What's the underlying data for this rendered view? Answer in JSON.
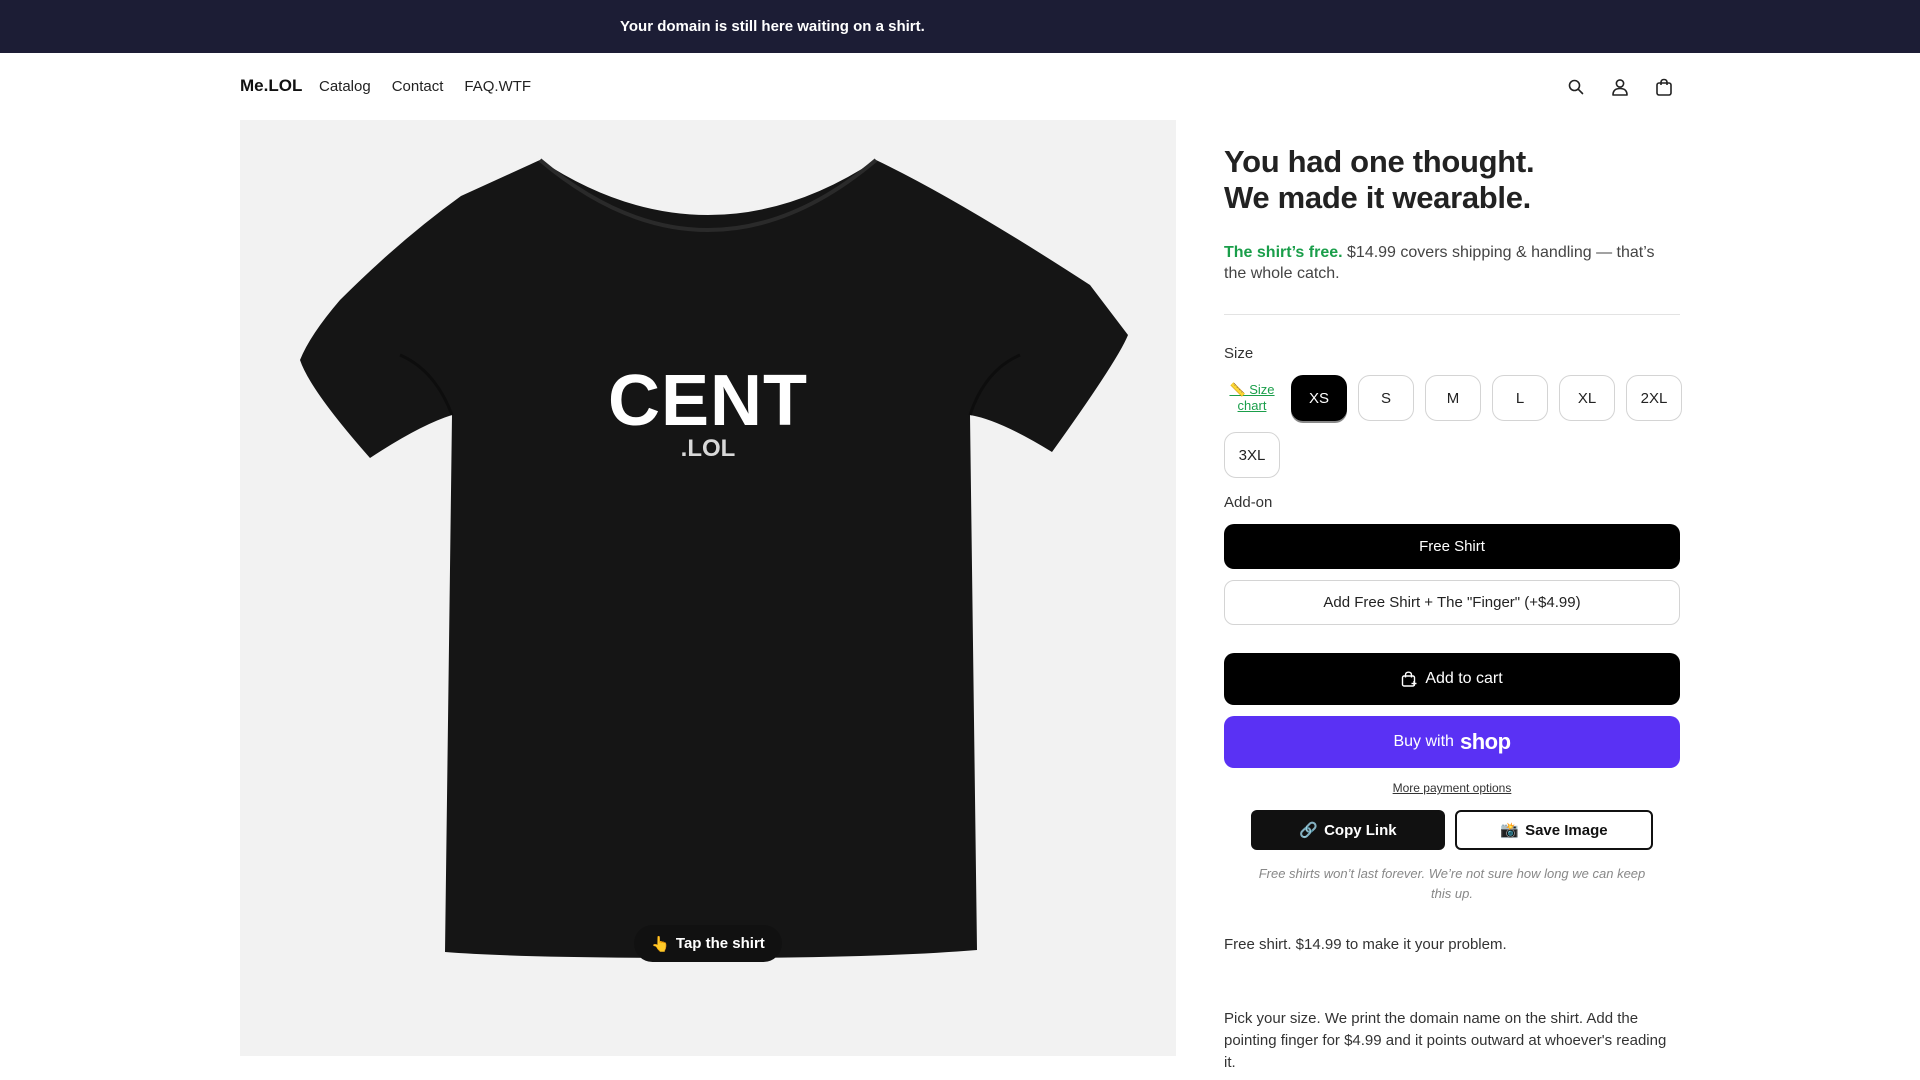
{
  "announcement": "Your domain is still here waiting on a shirt.",
  "header": {
    "logo": "Me.LOL",
    "nav": [
      "Catalog",
      "Contact",
      "FAQ.WTF"
    ]
  },
  "product": {
    "shirt_word": "CENT",
    "shirt_suffix": ".LOL",
    "tap_label": "Tap the shirt",
    "tap_icon": "👆",
    "title_line1": "You had one thought.",
    "title_line2": "We made it wearable.",
    "price_free": "The shirt’s free.",
    "price_rest": "$14.99 covers shipping & handling — that’s the whole catch.",
    "size_label": "Size",
    "size_chart_label": "📏 Size chart",
    "sizes": [
      "XS",
      "S",
      "M",
      "L",
      "XL",
      "2XL",
      "3XL"
    ],
    "selected_size": "XS",
    "addon_label": "Add-on",
    "addon_options": [
      "Free Shirt",
      "Add Free Shirt + The \"Finger\" (+$4.99)"
    ],
    "add_to_cart": "Add to cart",
    "buy_with": "Buy with",
    "shop_brand": "shop",
    "more_payment": "More payment options",
    "copy_link": "Copy Link",
    "copy_icon": "🔗",
    "save_image": "Save Image",
    "save_icon": "📸",
    "disclaimer": "Free shirts won’t last forever. We’re not sure how long we can keep this up.",
    "desc1": "Free shirt. $14.99 to make it your problem.",
    "desc2": "Pick your size. We print the domain name on the shirt. Add the pointing finger for $4.99 and it points outward at whoever's reading it."
  },
  "colors": {
    "announcement_bg": "#1c1d35",
    "accent_green": "#1a9e4a",
    "shop_purple": "#5a31f4"
  },
  "icons": {
    "search": "search-icon",
    "account": "account-icon",
    "cart": "cart-icon"
  }
}
